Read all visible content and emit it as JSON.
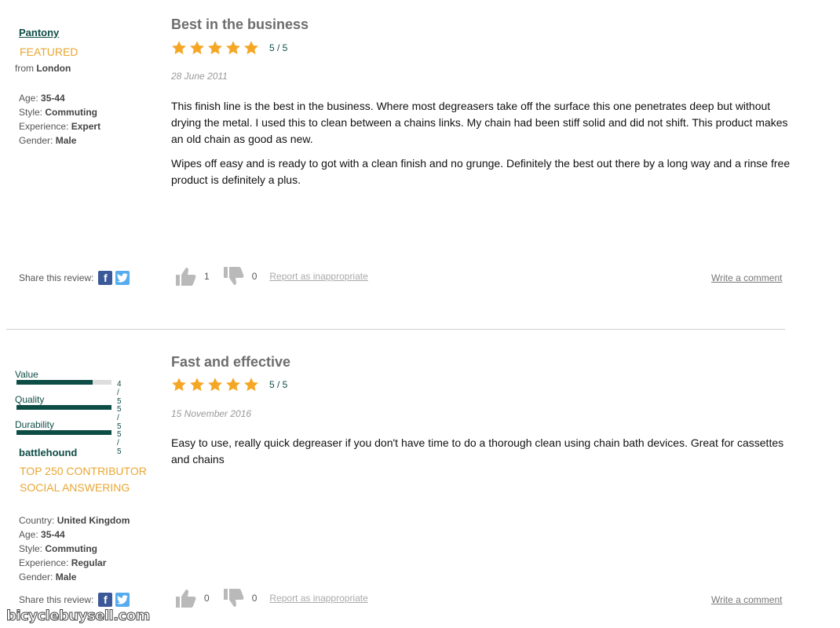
{
  "review1": {
    "username": "Pantony",
    "badge": "FEATURED",
    "from_prefix": "from",
    "location": "London",
    "meta": [
      {
        "label": "Age:",
        "value": "35-44"
      },
      {
        "label": "Style:",
        "value": "Commuting"
      },
      {
        "label": "Experience:",
        "value": "Expert"
      },
      {
        "label": "Gender:",
        "value": "Male"
      }
    ],
    "title": "Best in the business",
    "rating": 5,
    "score_text": "5 / 5",
    "date": "28 June 2011",
    "paragraphs": [
      "This finish line is the best in the business. Where most degreasers take off the surface this one penetrates deep but without drying the metal. I used this to clean between a chains links. My chain had been stiff solid and did not shift. This product makes an old chain as good as new.",
      "Wipes off easy and is ready to got with a clean finish and no grunge. Definitely the best out there by a long way and a rinse free product is definitely a plus."
    ],
    "share_label": "Share this review:",
    "upvotes": "1",
    "downvotes": "0",
    "report_label": "Report as inappropriate",
    "write_comment": "Write a comment"
  },
  "review2": {
    "ratings": [
      {
        "label": "Value",
        "value": 4,
        "max": 5,
        "text": "4 / 5"
      },
      {
        "label": "Quality",
        "value": 5,
        "max": 5,
        "text": "5 / 5"
      },
      {
        "label": "Durability",
        "value": 5,
        "max": 5,
        "text": "5 / 5"
      }
    ],
    "username": "battlehound",
    "badges": [
      "TOP 250 CONTRIBUTOR",
      "SOCIAL ANSWERING"
    ],
    "meta": [
      {
        "label": "Country:",
        "value": "United Kingdom"
      },
      {
        "label": "Age:",
        "value": "35-44"
      },
      {
        "label": "Style:",
        "value": "Commuting"
      },
      {
        "label": "Experience:",
        "value": "Regular"
      },
      {
        "label": "Gender:",
        "value": "Male"
      }
    ],
    "title": "Fast and effective",
    "rating": 5,
    "score_text": "5 / 5",
    "date": "15 November 2016",
    "paragraphs": [
      "Easy to use, really quick degreaser if you don't have time to do a thorough clean using chain bath devices. Great for cassettes and chains"
    ],
    "share_label": "Share this review:",
    "upvotes": "0",
    "downvotes": "0",
    "report_label": "Report as inappropriate",
    "write_comment": "Write a comment"
  },
  "icons": {
    "star": "star-icon",
    "facebook": "facebook-icon",
    "twitter": "twitter-icon",
    "thumbs_up": "thumbs-up-icon",
    "thumbs_down": "thumbs-down-icon"
  },
  "colors": {
    "brand": "#0e4d46",
    "badge": "#e8a632",
    "star": "#f5a623",
    "facebook": "#3b5998",
    "twitter": "#55acee"
  },
  "watermark": "bicyclebuysell.com"
}
